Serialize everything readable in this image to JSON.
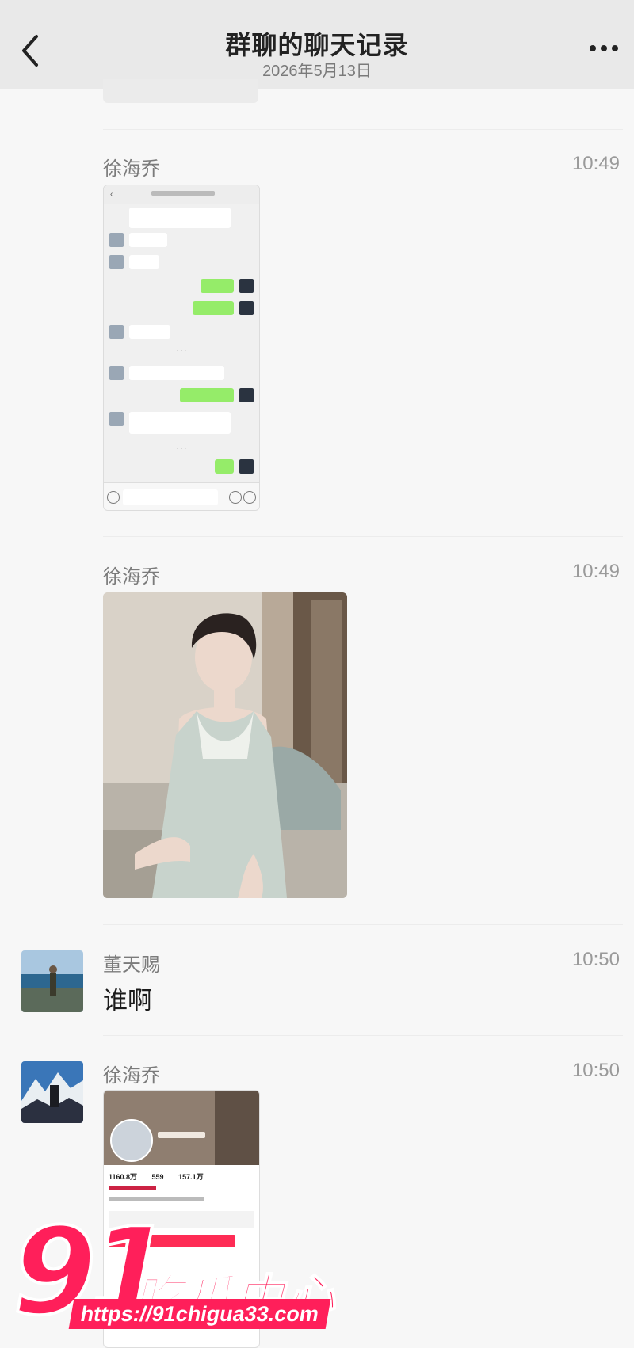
{
  "header": {
    "title": "群聊的聊天记录",
    "subtitle": "2026年5月13日",
    "back_icon": "chevron-left-icon",
    "more_label": "..."
  },
  "messages": [
    {
      "sender": "徐海乔",
      "time": "10:49",
      "type": "image",
      "image": "chat-screenshot"
    },
    {
      "sender": "徐海乔",
      "time": "10:49",
      "type": "image",
      "image": "photo-woman-in-nightgown"
    },
    {
      "sender": "董天赐",
      "time": "10:50",
      "type": "text",
      "text": "谁啊"
    },
    {
      "sender": "徐海乔",
      "time": "10:50",
      "type": "image",
      "image": "social-profile-screenshot"
    }
  ],
  "profile_stats": [
    "1160.8万",
    "559",
    "157.1万"
  ],
  "watermark": {
    "number": "91",
    "text": "吃瓜中心",
    "url": "https://91chigua33.com"
  },
  "colors": {
    "header_bg": "#e9e9e9",
    "page_bg": "#f7f7f7",
    "bubble_green": "#95ec69",
    "watermark": "#ff1f5a"
  }
}
